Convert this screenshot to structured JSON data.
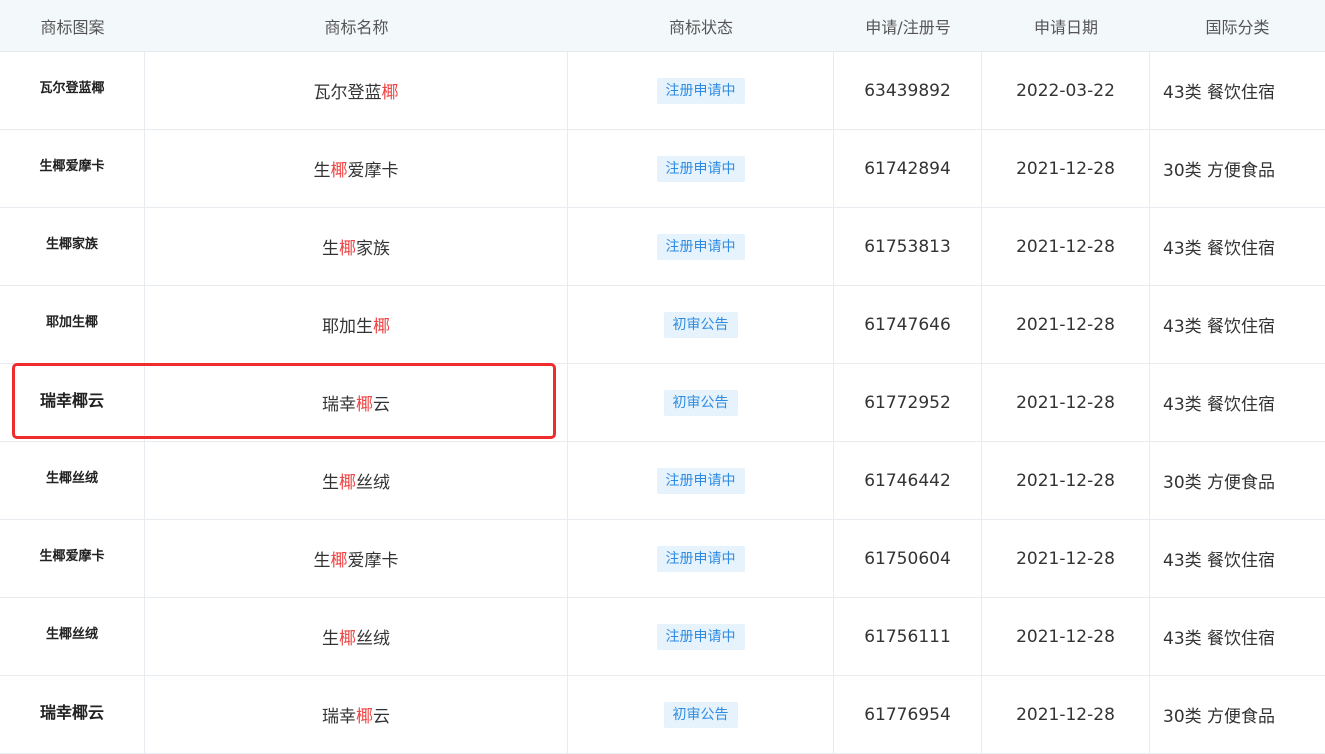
{
  "headers": {
    "pattern": "商标图案",
    "name": "商标名称",
    "status": "商标状态",
    "reg_no": "申请/注册号",
    "date": "申请日期",
    "intl_class": "国际分类"
  },
  "colors": {
    "highlight_char": "#ef4444",
    "badge_bg": "#e6f3fd",
    "badge_text": "#2f8be0",
    "annotation_box": "#ef2b2b"
  },
  "rows": [
    {
      "logo": "瓦尔登蓝椰",
      "name_pre": "瓦尔登蓝",
      "name_hl": "椰",
      "name_post": "",
      "status": "注册申请中",
      "reg_no": "63439892",
      "date": "2022-03-22",
      "intl_class": "43类 餐饮住宿"
    },
    {
      "logo": "生椰爱摩卡",
      "name_pre": "生",
      "name_hl": "椰",
      "name_post": "爱摩卡",
      "status": "注册申请中",
      "reg_no": "61742894",
      "date": "2021-12-28",
      "intl_class": "30类 方便食品"
    },
    {
      "logo": "生椰家族",
      "name_pre": "生",
      "name_hl": "椰",
      "name_post": "家族",
      "status": "注册申请中",
      "reg_no": "61753813",
      "date": "2021-12-28",
      "intl_class": "43类 餐饮住宿"
    },
    {
      "logo": "耶加生椰",
      "name_pre": "耶加生",
      "name_hl": "椰",
      "name_post": "",
      "status": "初审公告",
      "reg_no": "61747646",
      "date": "2021-12-28",
      "intl_class": "43类 餐饮住宿"
    },
    {
      "logo": "瑞幸椰云",
      "name_pre": "瑞幸",
      "name_hl": "椰",
      "name_post": "云",
      "status": "初审公告",
      "reg_no": "61772952",
      "date": "2021-12-28",
      "intl_class": "43类 餐饮住宿"
    },
    {
      "logo": "生椰丝绒",
      "name_pre": "生",
      "name_hl": "椰",
      "name_post": "丝绒",
      "status": "注册申请中",
      "reg_no": "61746442",
      "date": "2021-12-28",
      "intl_class": "30类 方便食品"
    },
    {
      "logo": "生椰爱摩卡",
      "name_pre": "生",
      "name_hl": "椰",
      "name_post": "爱摩卡",
      "status": "注册申请中",
      "reg_no": "61750604",
      "date": "2021-12-28",
      "intl_class": "43类 餐饮住宿"
    },
    {
      "logo": "生椰丝绒",
      "name_pre": "生",
      "name_hl": "椰",
      "name_post": "丝绒",
      "status": "注册申请中",
      "reg_no": "61756111",
      "date": "2021-12-28",
      "intl_class": "43类 餐饮住宿"
    },
    {
      "logo": "瑞幸椰云",
      "name_pre": "瑞幸",
      "name_hl": "椰",
      "name_post": "云",
      "status": "初审公告",
      "reg_no": "61776954",
      "date": "2021-12-28",
      "intl_class": "30类 方便食品"
    }
  ]
}
